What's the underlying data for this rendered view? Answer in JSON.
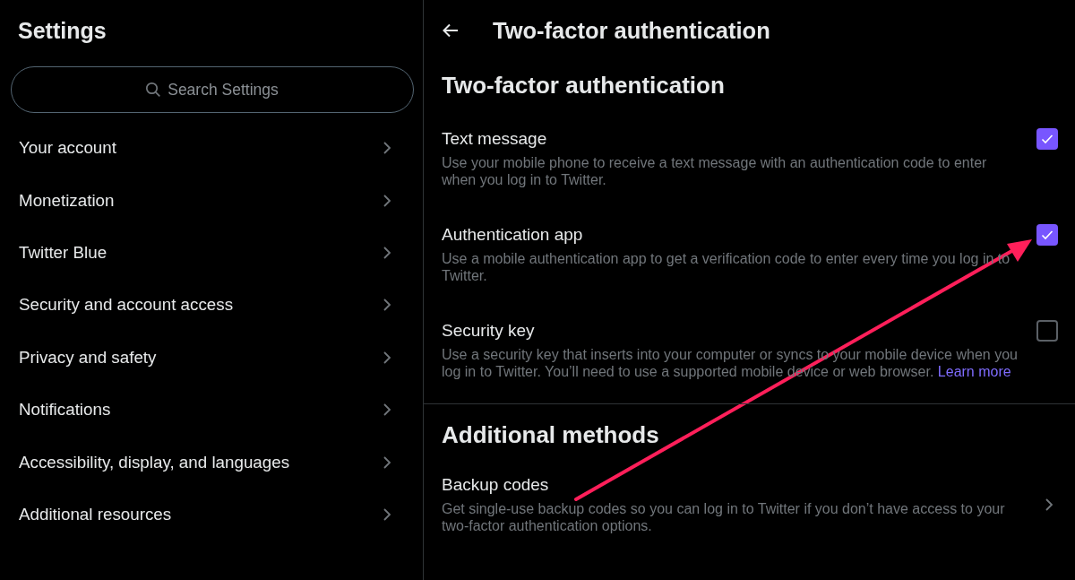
{
  "sidebar": {
    "title": "Settings",
    "search": {
      "placeholder": "Search Settings"
    },
    "items": [
      {
        "label": "Your account"
      },
      {
        "label": "Monetization"
      },
      {
        "label": "Twitter Blue"
      },
      {
        "label": "Security and account access"
      },
      {
        "label": "Privacy and safety"
      },
      {
        "label": "Notifications"
      },
      {
        "label": "Accessibility, display, and languages"
      },
      {
        "label": "Additional resources"
      }
    ]
  },
  "main": {
    "header": {
      "title": "Two-factor authentication"
    },
    "sections": [
      {
        "heading": "Two-factor authentication",
        "options": [
          {
            "kind": "checkbox",
            "title": "Text message",
            "description": "Use your mobile phone to receive a text message with an authentication code to enter when you log in to Twitter.",
            "checked": true
          },
          {
            "kind": "checkbox",
            "title": "Authentication app",
            "description": "Use a mobile authentication app to get a verification code to enter every time you log in to Twitter.",
            "checked": true
          },
          {
            "kind": "checkbox",
            "title": "Security key",
            "description": "Use a security key that inserts into your computer or syncs to your mobile device when you log in to Twitter. You’ll need to use a supported mobile device or web browser.",
            "link": "Learn more",
            "checked": false
          }
        ]
      },
      {
        "heading": "Additional methods",
        "options": [
          {
            "kind": "link",
            "title": "Backup codes",
            "description": "Get single-use backup codes so you can log in to Twitter if you don’t have access to your two-factor authentication options."
          }
        ]
      }
    ]
  }
}
